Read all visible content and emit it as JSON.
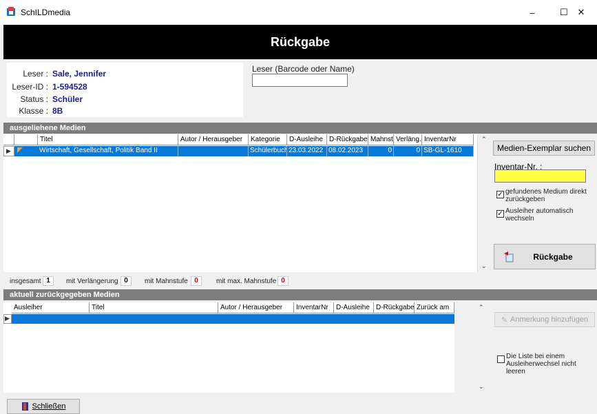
{
  "window": {
    "title": "SchILDmedia",
    "minimize": "–",
    "maximize": "☐",
    "close": "✕"
  },
  "header": {
    "title": "Rückgabe"
  },
  "reader": {
    "fields": [
      {
        "label": "Leser :",
        "value": "Sale, Jennifer"
      },
      {
        "label": "Leser-ID :",
        "value": "1-594528"
      },
      {
        "label": "Status :",
        "value": "Schüler"
      },
      {
        "label": "Klasse :",
        "value": "8B"
      }
    ],
    "input_label": "Leser (Barcode oder Name)",
    "input_value": ""
  },
  "lent": {
    "section_title": "ausgeliehene Medien",
    "columns": [
      "Titel",
      "Autor / Herausgeber",
      "Kategorie",
      "D-Ausleihe",
      "D-Rückgabe",
      "Mahnst.",
      "Verläng.",
      "InventarNr"
    ],
    "rows": [
      {
        "titel": "Wirtschaft, Gesellschaft, Politik Band II",
        "autor": "",
        "kategorie": "Schülerbuch",
        "d_ausleihe": "23.03.2022",
        "d_rueckgabe": "08.02.2023",
        "mahnst": "0",
        "verlaeng": "0",
        "inventar": "SB-GL-1610"
      }
    ]
  },
  "right_panel": {
    "find_button": "Medien-Exemplar suchen",
    "inventar_label": "Inventar-Nr. :",
    "inventar_value": "",
    "cb1_label": "gefundenes Medium direkt zurückgeben",
    "cb2_label": "Ausleiher automatisch wechseln",
    "return_button": "Rückgabe"
  },
  "stats": {
    "total_label": "insgesamt",
    "total": "1",
    "ext_label": "mit Verlängerung",
    "ext": "0",
    "dun_label": "mit Mahnstufe",
    "dun": "0",
    "maxdun_label": "mit max. Mahnstufe",
    "maxdun": "0"
  },
  "returned": {
    "section_title": "aktuell zurückgegeben Medien",
    "columns": [
      "Ausleiher",
      "Titel",
      "Autor / Herausgeber",
      "InventarNr",
      "D-Ausleihe",
      "D-Rückgabe",
      "Zurück am"
    ],
    "note_button": "Anmerkung hinzufügen",
    "cb_label": "Die Liste bei einem Ausleiherwechsel nicht leeren"
  },
  "footer": {
    "close_button": "Schließen"
  },
  "colors": {
    "selection": "#0a78d7",
    "inventar_field": "#ffff40",
    "header_bg": "#000000"
  },
  "icons": [
    "app-icon",
    "return-icon",
    "close-door-icon",
    "note-icon"
  ]
}
